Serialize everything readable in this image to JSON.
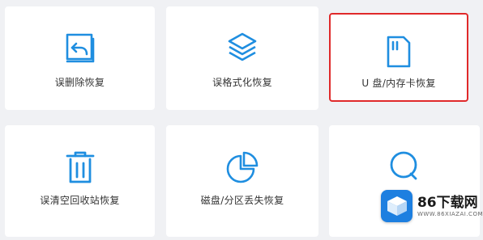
{
  "cards": [
    {
      "label": "误删除恢复",
      "icon": "recycle-file-icon"
    },
    {
      "label": "误格式化恢复",
      "icon": "layers-icon"
    },
    {
      "label": "U 盘/内存卡恢复",
      "icon": "sd-card-icon",
      "selected": true
    },
    {
      "label": "误清空回收站恢复",
      "icon": "trash-icon"
    },
    {
      "label": "磁盘/分区丢失恢复",
      "icon": "pie-chart-icon"
    },
    {
      "label": "",
      "icon": "search-icon"
    }
  ],
  "watermark": {
    "title": "86下载网",
    "subtitle": "WWW.86XIAZAI.COM"
  },
  "colors": {
    "accent": "#1f8ee0",
    "selected_border": "#e0292a",
    "background": "#f0f1f4"
  }
}
